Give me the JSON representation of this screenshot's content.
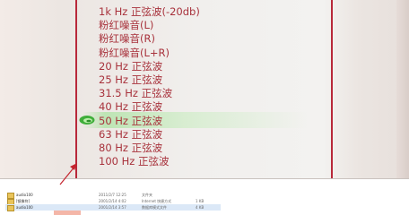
{
  "tone_list": {
    "items": [
      "1k Hz 正弦波(-20db)",
      "粉红噪音(L)",
      "粉红噪音(R)",
      "粉红噪音(L+R)",
      "20 Hz 正弦波",
      "25 Hz 正弦波",
      "31.5 Hz 正弦波",
      "40 Hz 正弦波",
      "50 Hz 正弦波",
      "63 Hz 正弦波",
      "80 Hz 正弦波",
      "100 Hz 正弦波"
    ],
    "playing_index": 8
  },
  "file_list": {
    "rows": [
      {
        "name": "audio100",
        "date": "2011/2/7 12:25",
        "type": "文件夹",
        "size": ""
      },
      {
        "name": "[镜像符]",
        "date": "2001/2/14 4:02",
        "type": "Internet 快捷方式",
        "size": "1 KB"
      },
      {
        "name": "audio100",
        "date": "2001/2/14 3:57",
        "type": "数据库模式文件",
        "size": "4 KB"
      }
    ]
  },
  "colors": {
    "accent_red": "#b8283a",
    "text_red": "#a8323c",
    "highlight_green": "#8fd685"
  }
}
